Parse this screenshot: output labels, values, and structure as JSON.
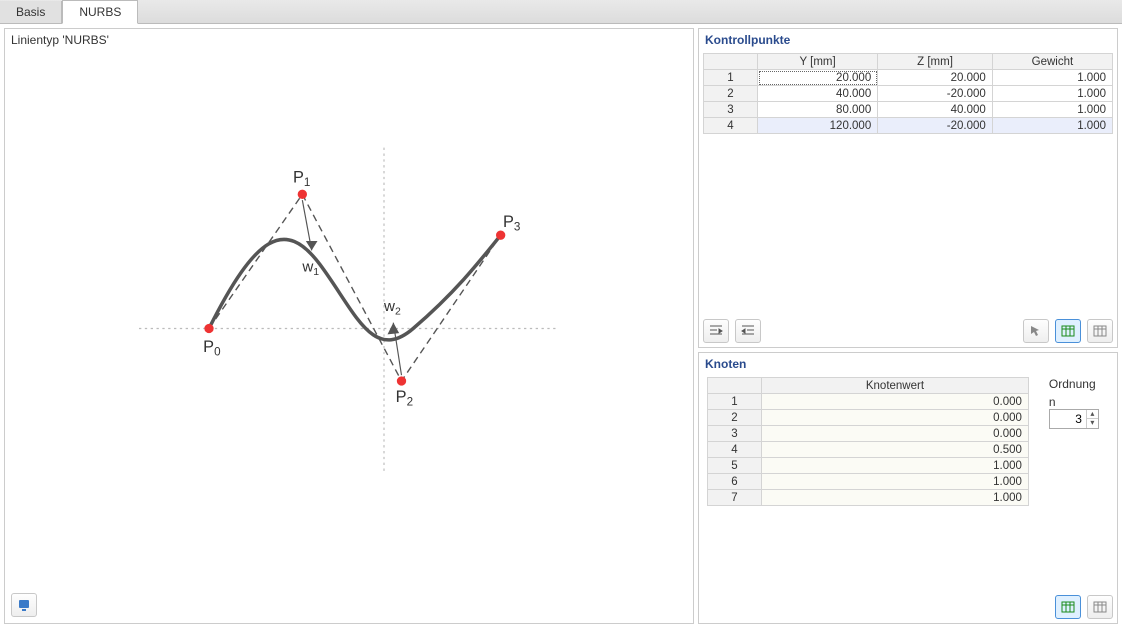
{
  "tabs": {
    "basis": "Basis",
    "nurbs": "NURBS"
  },
  "kontrollpunkte": {
    "title": "Kontrollpunkte",
    "headers": {
      "y": "Y [mm]",
      "z": "Z [mm]",
      "gew": "Gewicht"
    },
    "rows": [
      {
        "n": "1",
        "y": "20.000",
        "z": "20.000",
        "g": "1.000"
      },
      {
        "n": "2",
        "y": "40.000",
        "z": "-20.000",
        "g": "1.000"
      },
      {
        "n": "3",
        "y": "80.000",
        "z": "40.000",
        "g": "1.000"
      },
      {
        "n": "4",
        "y": "120.000",
        "z": "-20.000",
        "g": "1.000"
      }
    ]
  },
  "knoten": {
    "title": "Knoten",
    "header": "Knotenwert",
    "rows": [
      {
        "n": "1",
        "v": "0.000"
      },
      {
        "n": "2",
        "v": "0.000"
      },
      {
        "n": "3",
        "v": "0.000"
      },
      {
        "n": "4",
        "v": "0.500"
      },
      {
        "n": "5",
        "v": "1.000"
      },
      {
        "n": "6",
        "v": "1.000"
      },
      {
        "n": "7",
        "v": "1.000"
      }
    ],
    "ordnung": {
      "label": "Ordnung",
      "n_label": "n",
      "value": "3"
    }
  },
  "preview": {
    "title": "Linientyp 'NURBS'",
    "labels": {
      "p0": "P",
      "p1": "P",
      "p2": "P",
      "p3": "P",
      "w1": "w",
      "w2": "w"
    }
  }
}
